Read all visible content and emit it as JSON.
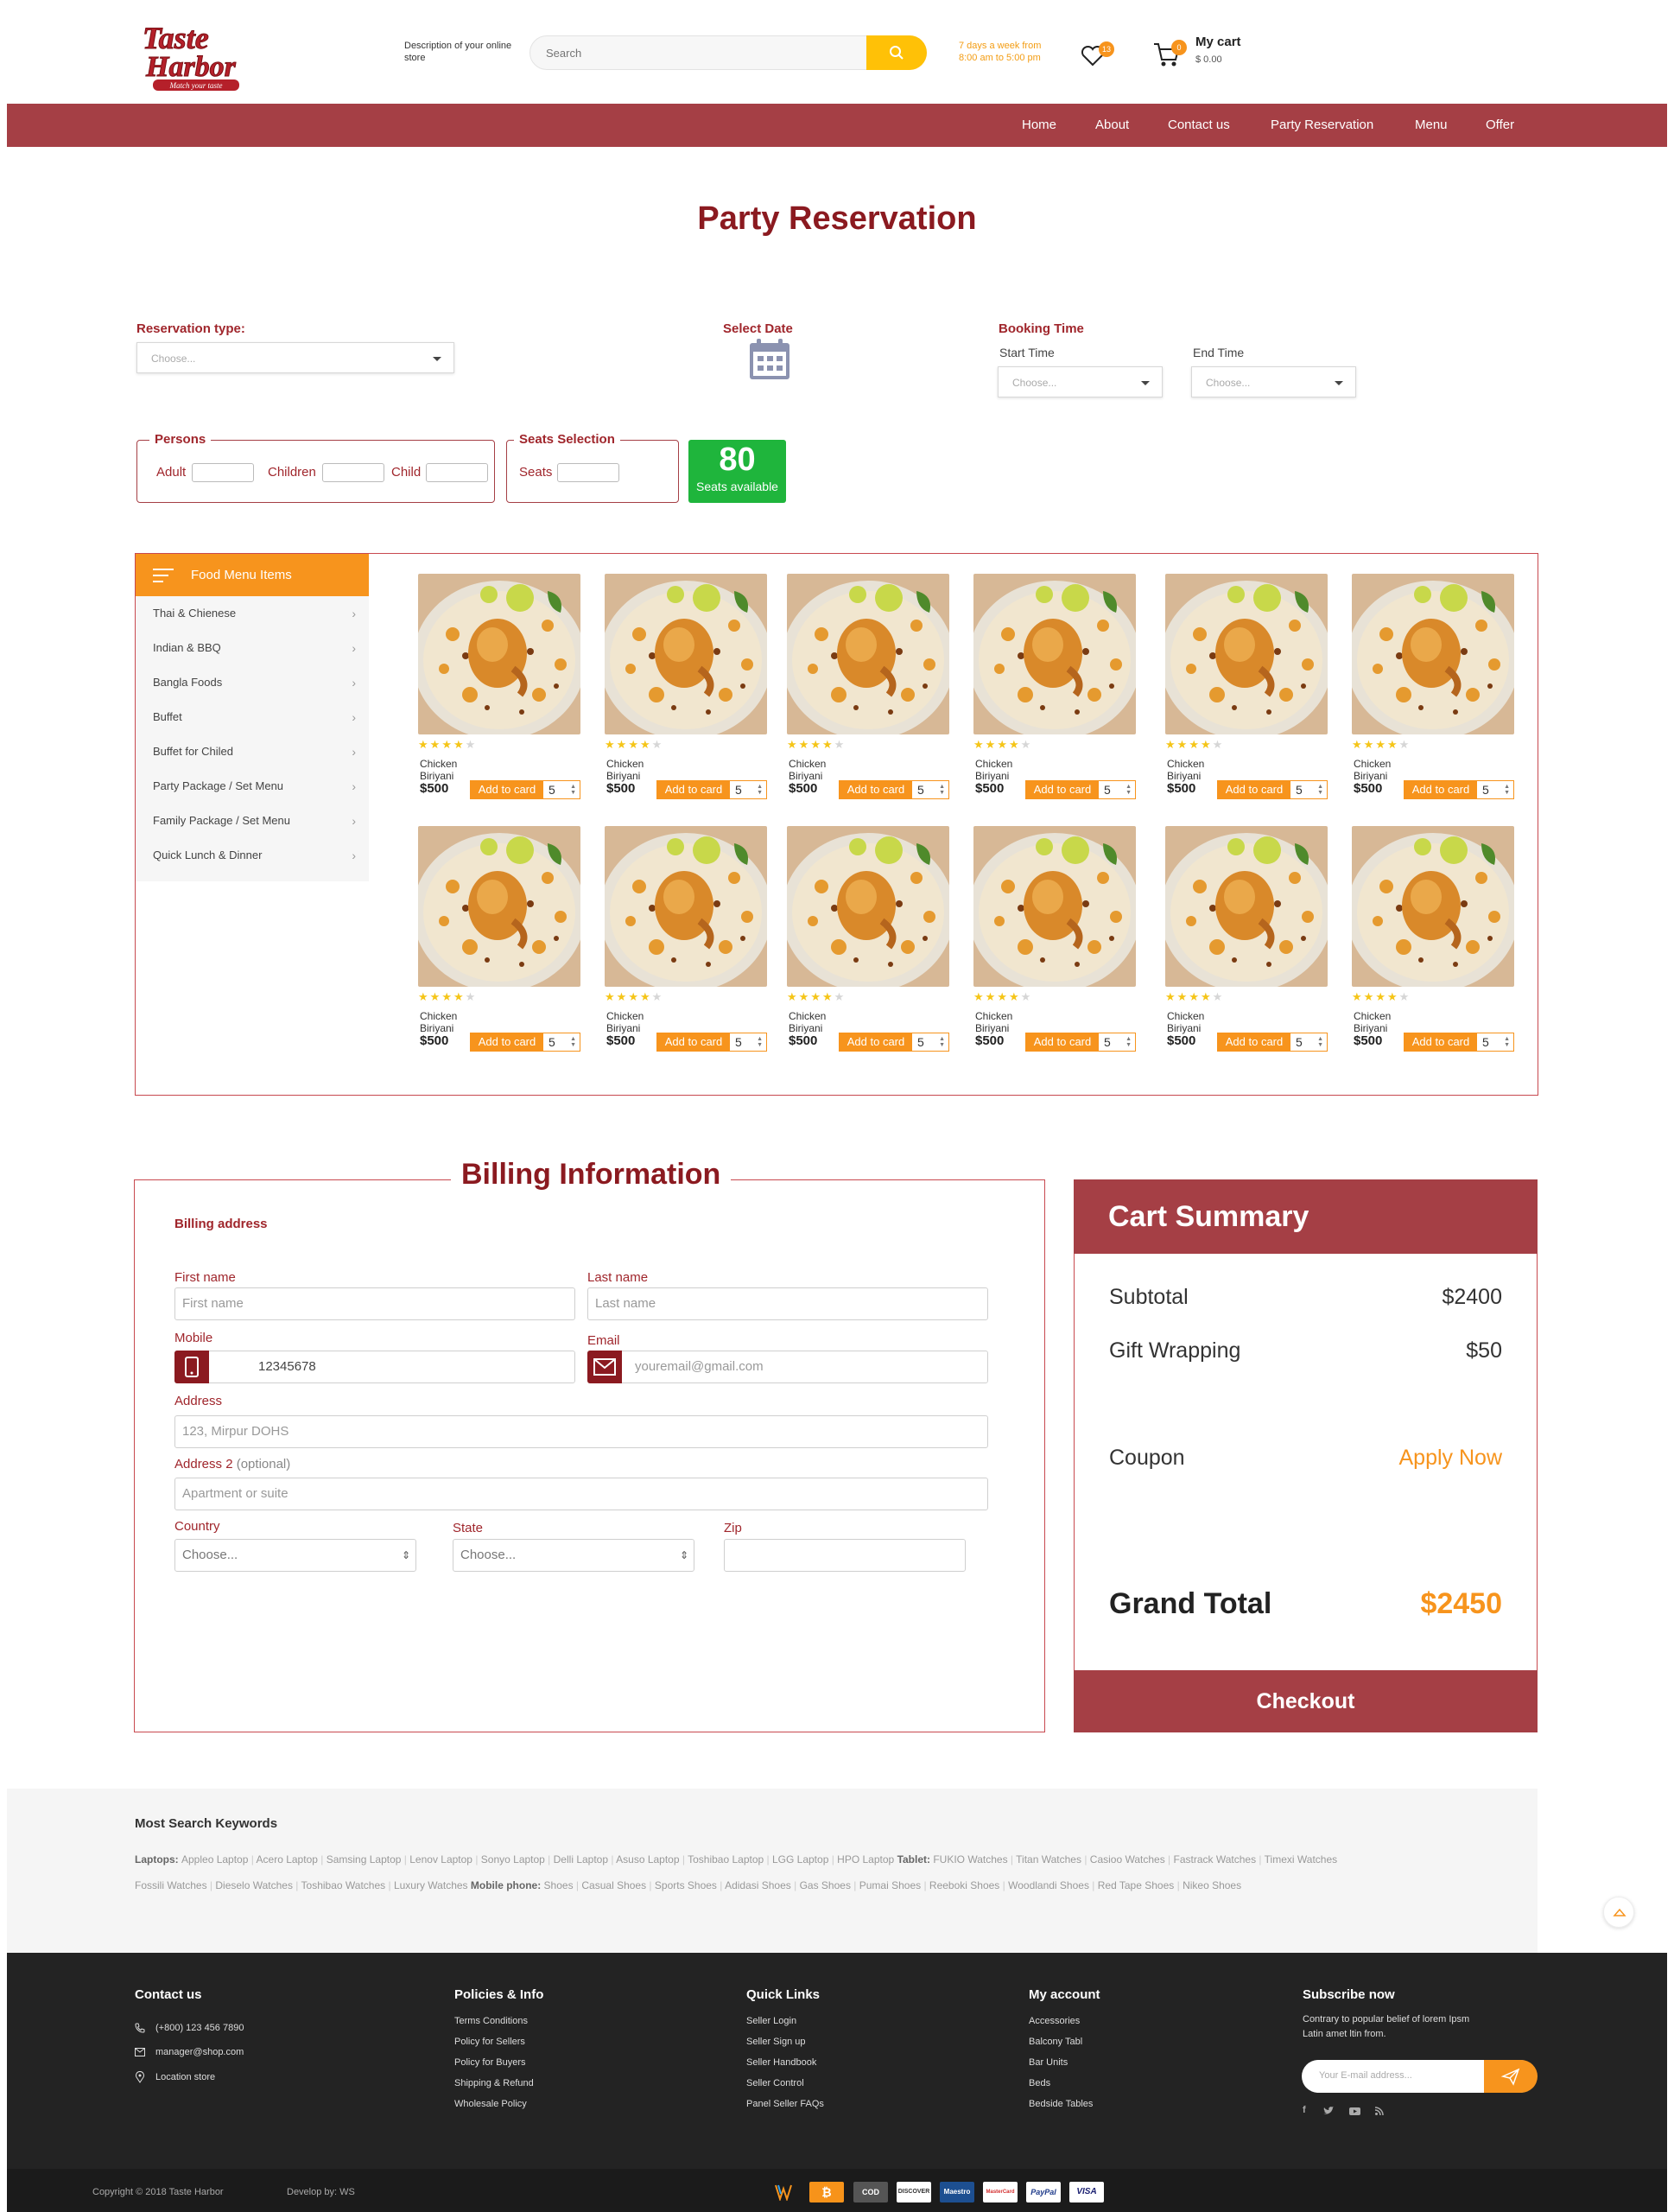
{
  "header": {
    "logo_line1": "Taste",
    "logo_line2": "Harbor",
    "logo_tagline": "Match your taste",
    "store_description": "Description of your online store",
    "search_placeholder": "Search",
    "hours_line1": "7 days a week from",
    "hours_line2": "8:00 am to 5:00 pm",
    "wishlist_count": "13",
    "cart_count": "0",
    "cart_label": "My cart",
    "cart_amount": "$ 0.00"
  },
  "nav": [
    "Home",
    "About",
    "Contact us",
    "Party Reservation",
    "Menu",
    "Offer"
  ],
  "page_title": "Party Reservation",
  "reservation": {
    "type_label": "Reservation type:",
    "type_value": "Choose...",
    "date_label": "Select Date",
    "booking_time_label": "Booking Time",
    "start_label": "Start Time",
    "start_value": "Choose...",
    "end_label": "End Time",
    "end_value": "Choose..."
  },
  "persons": {
    "legend": "Persons",
    "adult": "Adult",
    "children": "Children",
    "child": "Child"
  },
  "seats": {
    "legend": "Seats Selection",
    "seats_label": "Seats",
    "available_count": "80",
    "available_label": "Seats available"
  },
  "food_menu": {
    "title": "Food Menu Items",
    "categories": [
      "Thai & Chienese",
      "Indian & BBQ",
      "Bangla Foods",
      "Buffet",
      "Buffet for Chiled",
      "Party Package / Set Menu",
      "Family Package / Set Menu",
      "Quick Lunch & Dinner"
    ]
  },
  "products": [
    {
      "name": "Chicken  Biriyani",
      "price": "$500",
      "rating": 4,
      "button": "Add to card",
      "qty": "5"
    },
    {
      "name": "Chicken  Biriyani",
      "price": "$500",
      "rating": 4,
      "button": "Add to card",
      "qty": "5"
    },
    {
      "name": "Chicken  Biriyani",
      "price": "$500",
      "rating": 4,
      "button": "Add to card",
      "qty": "5"
    },
    {
      "name": "Chicken  Biriyani",
      "price": "$500",
      "rating": 4,
      "button": "Add to card",
      "qty": "5"
    },
    {
      "name": "Chicken  Biriyani",
      "price": "$500",
      "rating": 4,
      "button": "Add to card",
      "qty": "5"
    },
    {
      "name": "Chicken  Biriyani",
      "price": "$500",
      "rating": 4,
      "button": "Add to card",
      "qty": "5"
    },
    {
      "name": "Chicken  Biriyani",
      "price": "$500",
      "rating": 4,
      "button": "Add to card",
      "qty": "5"
    },
    {
      "name": "Chicken  Biriyani",
      "price": "$500",
      "rating": 4,
      "button": "Add to card",
      "qty": "5"
    },
    {
      "name": "Chicken  Biriyani",
      "price": "$500",
      "rating": 4,
      "button": "Add to card",
      "qty": "5"
    },
    {
      "name": "Chicken  Biriyani",
      "price": "$500",
      "rating": 4,
      "button": "Add to card",
      "qty": "5"
    },
    {
      "name": "Chicken  Biriyani",
      "price": "$500",
      "rating": 4,
      "button": "Add to card",
      "qty": "5"
    },
    {
      "name": "Chicken  Biriyani",
      "price": "$500",
      "rating": 4,
      "button": "Add to card",
      "qty": "5"
    }
  ],
  "billing": {
    "title": "Billing Information",
    "subtitle": "Billing address",
    "first_name_label": "First name",
    "first_name_placeholder": "First name",
    "last_name_label": "Last  name",
    "last_name_placeholder": "Last  name",
    "mobile_label": "Mobile",
    "mobile_value": "12345678",
    "email_label": "Email",
    "email_placeholder": "youremail@gmail.com",
    "address_label": "Address",
    "address_placeholder": "123, Mirpur DOHS",
    "address2_label": "Address 2",
    "address2_optional": "(optional)",
    "address2_placeholder": "Apartment or suite",
    "country_label": "Country",
    "country_value": "Choose...",
    "state_label": "State",
    "state_value": "Choose...",
    "zip_label": "Zip"
  },
  "cart_summary": {
    "title": "Cart Summary",
    "subtotal_label": "Subtotal",
    "subtotal_value": "$2400",
    "gift_label": "Gift Wrapping",
    "gift_value": "$50",
    "coupon_label": "Coupon",
    "coupon_action": "Apply Now",
    "grand_label": "Grand Total",
    "grand_value": "$2450",
    "checkout": "Checkout"
  },
  "keywords": {
    "title": "Most Search Keywords",
    "line1": [
      {
        "cat": "Laptops:",
        "items": [
          "Appleo Laptop",
          "Acero Laptop",
          "Samsing Laptop",
          "Lenov Laptop",
          "Sonyo Laptop",
          "Delli Laptop",
          "Asuso Laptop",
          "Toshibao Laptop",
          "LGG Laptop",
          "HPO Laptop"
        ]
      },
      {
        "cat": "Tablet:",
        "items": [
          "FUKIO Watches",
          "Titan Watches",
          "Casioo Watches",
          "Fastrack Watches",
          "Timexi Watches"
        ]
      }
    ],
    "line2": [
      {
        "cat": "",
        "items": [
          "Fossili Watches",
          "Dieselo Watches",
          "Toshibao Watches",
          "Luxury Watches"
        ]
      },
      {
        "cat": "Mobile phone:",
        "items": [
          "Shoes",
          "Casual Shoes",
          "Sports Shoes",
          "Adidasi Shoes",
          "Gas Shoes",
          "Pumai Shoes",
          "Reeboki Shoes",
          "Woodlandi Shoes",
          "Red Tape Shoes",
          "Nikeo Shoes"
        ]
      }
    ]
  },
  "footer": {
    "contact_title": "Contact us",
    "phone": "(+800) 123 456 7890",
    "email": "manager@shop.com",
    "location": "Location store",
    "policies_title": "Policies & Info",
    "policies": [
      "Terms Conditions",
      "Policy for Sellers",
      "Policy for Buyers",
      "Shipping & Refund",
      "Wholesale Policy"
    ],
    "quick_title": "Quick Links",
    "quick": [
      "Seller Login",
      "Seller Sign up",
      "Seller Handbook",
      "Seller Control",
      "Panel Seller FAQs"
    ],
    "account_title": "My account",
    "account": [
      "Accessories",
      "Balcony Tabl",
      "Bar Units",
      "Beds",
      "Bedside Tables"
    ],
    "subscribe_title": "Subscribe now",
    "subscribe_text_1": "Contrary to popular belief of lorem Ipsm",
    "subscribe_text_2": "Latin amet ltin from.",
    "subscribe_placeholder": "Your E-mail address...",
    "copyright": "Copyright © 2018 Taste Harbor",
    "developer": "Develop by: WS",
    "payments": [
      "COD",
      "DISCOVER",
      "Maestro",
      "MasterCard",
      "PayPal",
      "VISA"
    ]
  },
  "colors": {
    "brand_red": "#a53f45",
    "dark_red": "#8b1a20",
    "orange": "#f7941d",
    "yellow": "#ffc107",
    "green": "#1fb53c"
  }
}
